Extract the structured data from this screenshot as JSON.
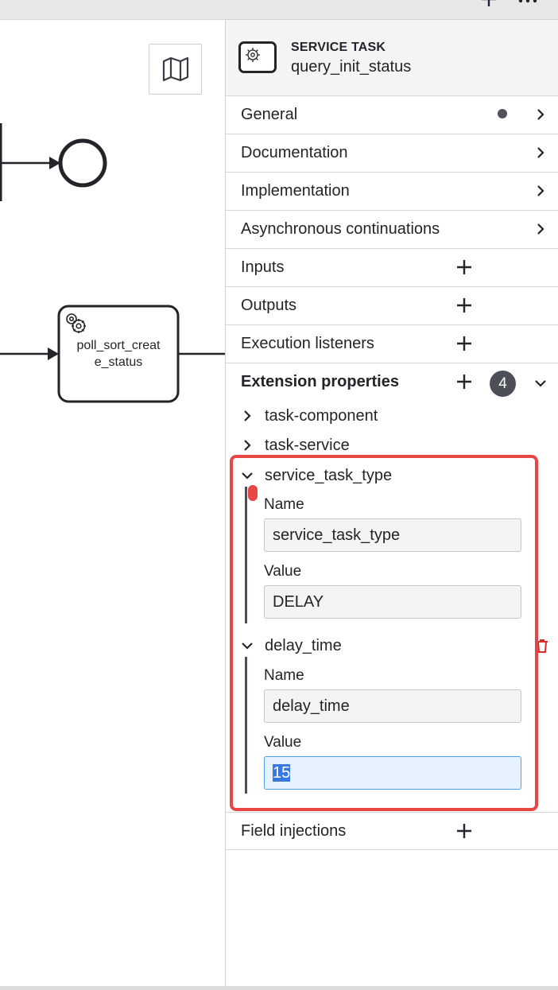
{
  "canvas": {
    "task_label_line1": "poll_sort_creat",
    "task_label_line2": "e_status"
  },
  "panel": {
    "header": {
      "type": "SERVICE TASK",
      "name": "query_init_status"
    },
    "groups": [
      {
        "label": "General",
        "has_dot": true
      },
      {
        "label": "Documentation"
      },
      {
        "label": "Implementation"
      },
      {
        "label": "Asynchronous continuations"
      },
      {
        "label": "Inputs"
      },
      {
        "label": "Outputs"
      },
      {
        "label": "Execution listeners"
      },
      {
        "label": "Extension properties",
        "count": "4",
        "expanded": true
      },
      {
        "label": "Field injections"
      }
    ],
    "extension_properties": [
      {
        "title": "task-component",
        "expanded": false
      },
      {
        "title": "task-service",
        "expanded": false
      },
      {
        "title": "service_task_type",
        "expanded": true,
        "name_label": "Name",
        "name_value": "service_task_type",
        "value_label": "Value",
        "value_value": "DELAY"
      },
      {
        "title": "delay_time",
        "expanded": true,
        "name_label": "Name",
        "name_value": "delay_time",
        "value_label": "Value",
        "value_value": "15"
      }
    ]
  },
  "colors": {
    "highlight": "#e84545",
    "focus_border": "#49a3e8",
    "selection": "#3778e2",
    "badge": "#4d4f58"
  },
  "icons": [
    "plus-icon",
    "more-icon",
    "map-icon",
    "gear-icon",
    "chevron-right-icon",
    "chevron-down-icon",
    "trash-icon"
  ]
}
